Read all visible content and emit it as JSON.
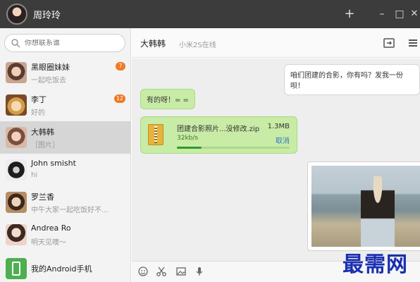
{
  "titlebar": {
    "user_name": "周玲玲",
    "add_label": "+",
    "minimize_label": "–",
    "maximize_label": "□",
    "close_label": "✕"
  },
  "search": {
    "placeholder": "你想联系谁"
  },
  "contacts": [
    {
      "name": "黑眼圈妹妹",
      "preview": "一起吃饭去",
      "badge": "7"
    },
    {
      "name": "李丁",
      "preview": "好的",
      "badge": "12"
    },
    {
      "name": "大韩韩",
      "preview": "［图片］",
      "badge": ""
    },
    {
      "name": "John smisht",
      "preview": "hi",
      "badge": ""
    },
    {
      "name": "罗兰香",
      "preview": "中午大家一起吃饭好不...",
      "badge": ""
    },
    {
      "name": "Andrea Ro",
      "preview": "明天见噢～",
      "badge": ""
    },
    {
      "name": "我的Android手机",
      "preview": "",
      "badge": ""
    }
  ],
  "chat": {
    "title": "大韩韩",
    "subtitle": "小米2S在线",
    "messages": {
      "outgoing_1": "咱们团建的合影，你有吗？发我一份呗！",
      "incoming_1": "有的呀！= =",
      "file": {
        "name": "团建合影照片...没修改.zip",
        "size": "1.3MB",
        "speed": "32kb/s",
        "cancel_label": "取消",
        "progress": 0.22
      }
    }
  },
  "icons": {
    "search": "search-icon",
    "folder": "folder-icon",
    "menu": "menu-icon",
    "emoji": "emoji-icon",
    "scissors": "scissors-icon",
    "image": "image-icon",
    "mic": "microphone-icon"
  },
  "colors": {
    "titlebar": "#3c3c3c",
    "bubble_in": "#c8eba6",
    "badge": "#f07a24",
    "link": "#2b7ac0",
    "watermark": "#1a2fb0"
  },
  "watermark": "最需网"
}
